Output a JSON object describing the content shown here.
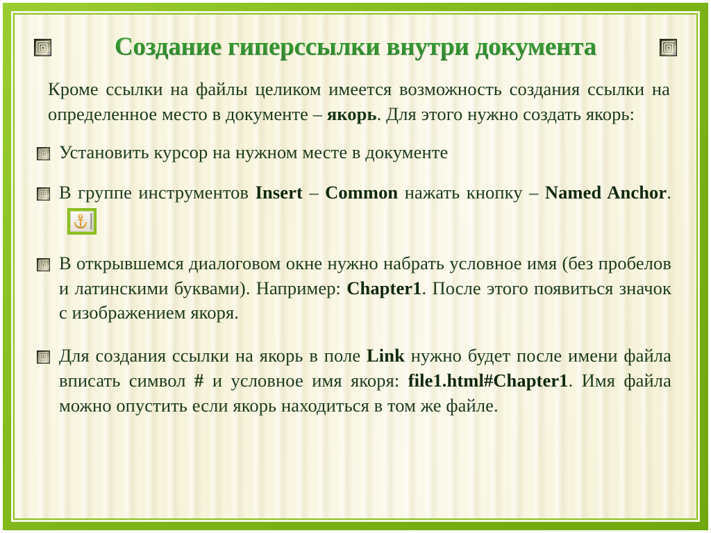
{
  "slide": {
    "title": "Создание гиперссылки внутри документа",
    "title_color": "#179117",
    "body_color": "#1c3b1c",
    "frame_color": "#7cb518",
    "page_background": "#f7f3d9",
    "left_title_icon": "spiral-square-icon",
    "right_title_icon": "spiral-square-icon"
  },
  "intro": {
    "text_part1": "Кроме ссылки на файлы целиком имеется возможность создания ссылки на определенное место в документе – ",
    "bold_term": "якорь",
    "text_part2": ". Для этого нужно создать якорь:"
  },
  "bullets": [
    {
      "icon": "spiral-square-bullet-icon",
      "text": " Установить курсор на нужном месте в документе"
    },
    {
      "icon": "spiral-square-bullet-icon",
      "text_part1": " В группе инструментов ",
      "bold_1": "Insert",
      "text_part2": " – ",
      "bold_2": "Common",
      "text_part3": " нажать кнопку – ",
      "bold_3": "Named Anchor",
      "text_part4": ".",
      "button": {
        "name": "named-anchor-button",
        "icon": "anchor-icon",
        "border_color": "#8fc31f",
        "face_color": "#eceae2"
      }
    },
    {
      "icon": "spiral-square-bullet-icon",
      "text_part1": " В открывшемся диалоговом окне нужно набрать условное имя (без пробелов и латинскими буквами). Например: ",
      "bold_1": "Chapter1",
      "text_part2": ".  После этого появиться значок с изображением якоря."
    },
    {
      "icon": "spiral-square-bullet-icon",
      "text_part1": " Для создания ссылки на якорь в поле ",
      "bold_1": "Link",
      "text_part2": " нужно будет после имени файла вписать  символ ",
      "symbol": "#",
      "text_part3": "  и условное имя якоря: ",
      "bold_2": "file1.html#Chapter1",
      "text_part4": ". Имя файла можно опустить если якорь находиться в том же файле."
    }
  ]
}
